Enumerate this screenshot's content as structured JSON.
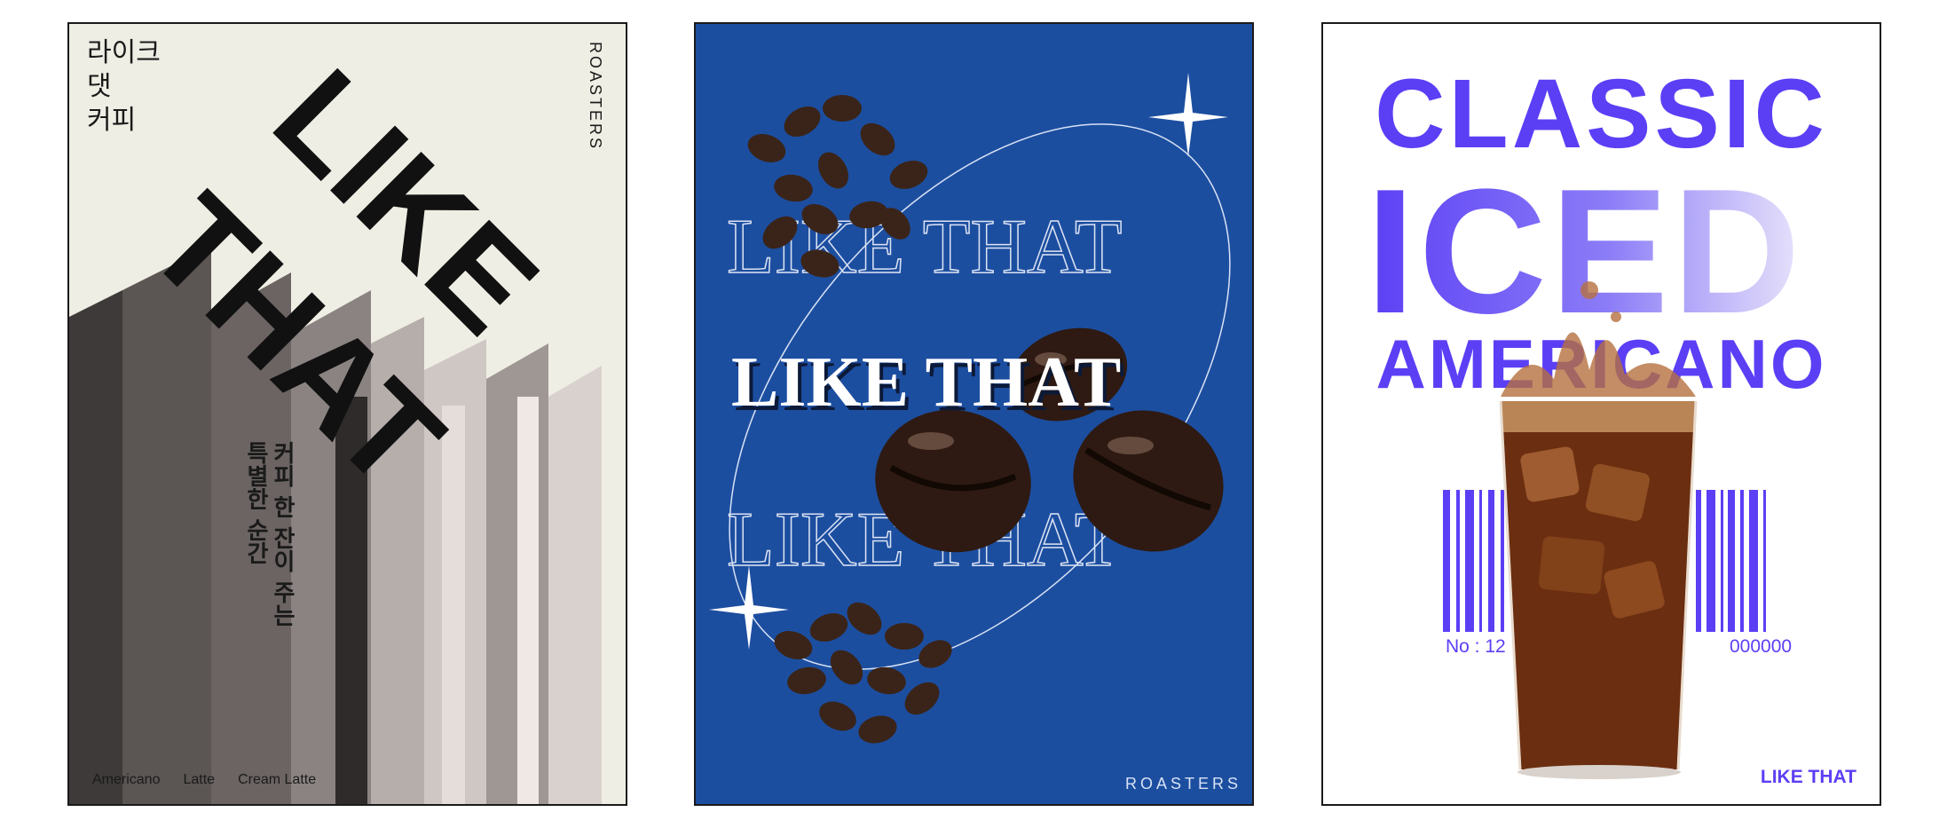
{
  "poster1": {
    "korean_title": [
      "라이크",
      "댓",
      "커피"
    ],
    "roasters": "ROASTERS",
    "big_word_1": "LIKE",
    "big_word_2": "THAT",
    "slogan_lines": [
      "커피 한 잔이 주는",
      "특별한 순간"
    ],
    "menu": [
      "Americano",
      "Latte",
      "Cream Latte"
    ],
    "colors": {
      "background": "#efeee4",
      "text": "#111111",
      "extrusion": "#5b5553"
    }
  },
  "poster2": {
    "headline": "LIKE THAT",
    "outline_top": "LIKE THAT",
    "outline_bottom": "LIKE THAT",
    "roasters": "ROASTERS",
    "colors": {
      "background": "#1c4ea0",
      "bean": "#3a2419"
    }
  },
  "poster3": {
    "line1": "CLASSIC",
    "line2": "ICED",
    "line3": "AMERICANO",
    "barcode_no_prefix": "No : 12",
    "barcode_no_suffix": "000000",
    "brand": "LIKE THAT",
    "colors": {
      "accent": "#5b3ff5",
      "coffee": "#6b2e10"
    }
  }
}
